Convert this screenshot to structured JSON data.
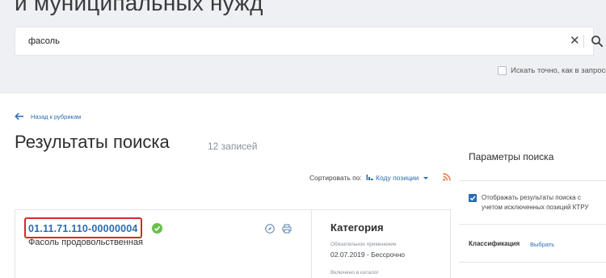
{
  "header": {
    "heading": "и муниципальных нужд"
  },
  "search": {
    "value": "фасоль",
    "placeholder": "",
    "clear_symbol": "✕",
    "exact_match_label": "Искать точно, как в запросе",
    "exact_match_checked": false
  },
  "nav": {
    "back_label": "Назад к рубрикам"
  },
  "results": {
    "title": "Результаты поиска",
    "count": "12 записей",
    "sort_label": "Сортировать по:",
    "sort_value": "Коду позиции",
    "items": [
      {
        "code": "01.11.71.110-00000004",
        "name": "Фасоль продовольственная",
        "verified": true,
        "category_title": "Категория",
        "required_label": "Обязательное применение",
        "required_value": "02.07.2019 - Бессрочно",
        "included_label": "Включено в каталог"
      }
    ]
  },
  "sidebar": {
    "title": "Параметры поиска",
    "show_excluded_label": "Отображать результаты поиска с учетом исключенных позиций КТРУ",
    "show_excluded_checked": true,
    "classification_label": "Классификация",
    "classification_action": "Выбрать"
  },
  "colors": {
    "accent": "#2a6db0",
    "highlight_border": "#d42a2a",
    "verified": "#6abf4b",
    "rss": "#e8743b",
    "top_background": "#eef0f3"
  },
  "icons": [
    "clear-icon",
    "search-icon",
    "back-arrow-icon",
    "sort-icon",
    "caret-down-icon",
    "rss-icon",
    "verified-check-icon",
    "compass-icon",
    "print-icon",
    "checkbox-checked-icon"
  ]
}
